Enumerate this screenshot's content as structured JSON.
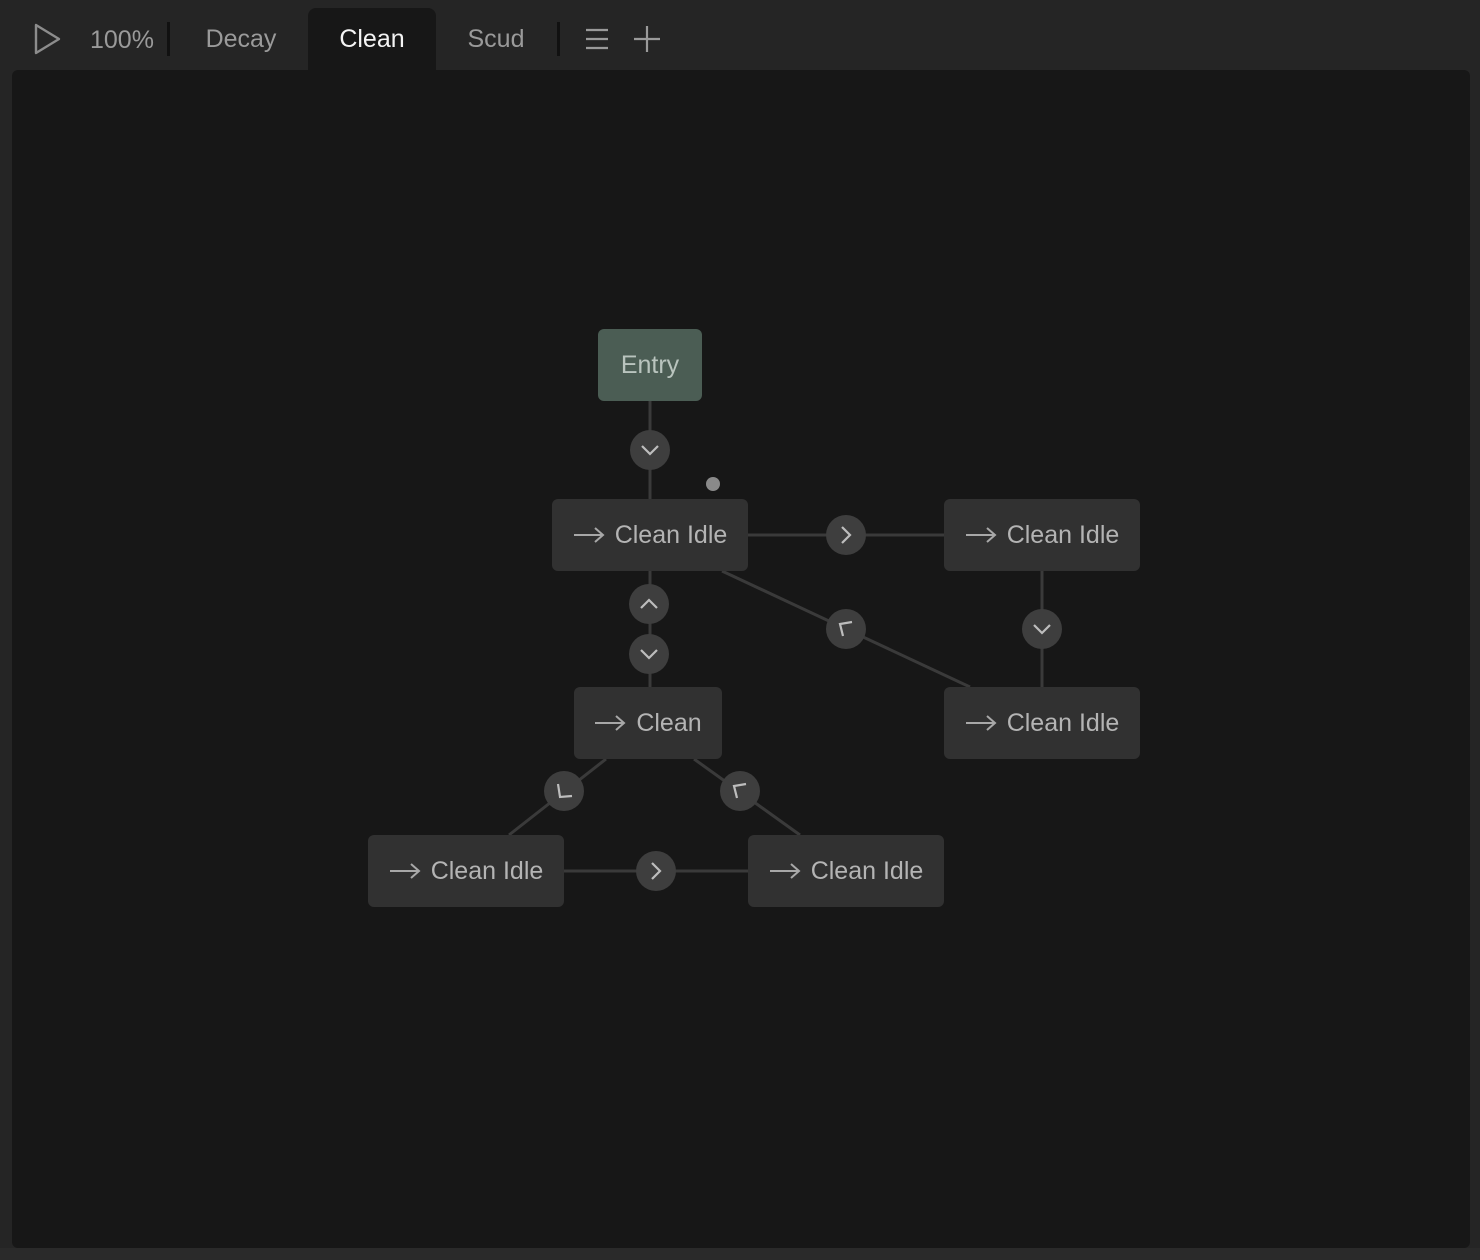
{
  "toolbar": {
    "zoom": "100%",
    "tabs": [
      {
        "label": "Decay",
        "active": false
      },
      {
        "label": "Clean",
        "active": true
      },
      {
        "label": "Scud",
        "active": false
      }
    ],
    "icons": {
      "play": "play-icon",
      "menu": "menu-icon",
      "add": "plus-icon"
    }
  },
  "graph": {
    "nodes": {
      "entry": "Entry",
      "idle_a": "Clean Idle",
      "idle_b": "Clean Idle",
      "idle_c": "Clean Idle",
      "clean": "Clean",
      "idle_d": "Clean Idle",
      "idle_e": "Clean Idle"
    }
  },
  "colors": {
    "background": "#252525",
    "canvas": "#171717",
    "node": "#313131",
    "entry_node": "#4b5d54",
    "badge": "#3e3e3e",
    "edge": "#3a3a3a",
    "active_tab_text": "#f4f4f4"
  }
}
